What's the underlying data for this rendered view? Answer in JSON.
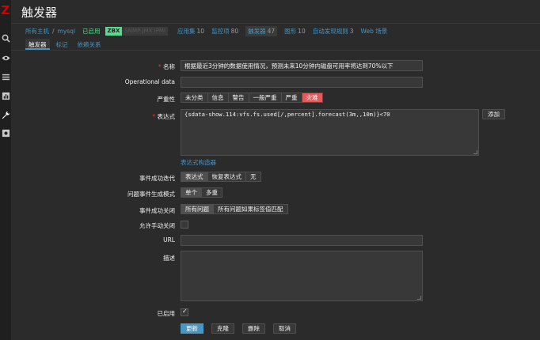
{
  "app": {
    "logo": "Z",
    "title": "触发器"
  },
  "sidebar": {
    "icons": [
      "search-icon",
      "eye-icon",
      "list-icon",
      "chart-icon",
      "wrench-icon",
      "gear-icon"
    ]
  },
  "subnav": {
    "all_hosts": "所有主机",
    "separator": "/",
    "host": "mysql",
    "status": "已启用",
    "zbx": "ZBX",
    "zbx_dim": "SNMP JMX IPMI",
    "applications": "应用集",
    "applications_count": "10",
    "items": "监控项",
    "items_count": "80",
    "triggers": "触发器",
    "triggers_count": "47",
    "graphs": "图形",
    "graphs_count": "10",
    "discovery": "自动发现规则",
    "discovery_count": "3",
    "web": "Web 场景"
  },
  "tabs": [
    {
      "label": "触发器"
    },
    {
      "label": "标记"
    },
    {
      "label": "依赖关系"
    }
  ],
  "form": {
    "name_label": "名称",
    "name_value": "根据最近3分钟的数据使用情况，预测未来10分钟内磁盘可用率将达到70%以下",
    "opdata_label": "Operational data",
    "opdata_value": "",
    "severity_label": "严重性",
    "severities": [
      "未分类",
      "信息",
      "警告",
      "一般严重",
      "严重",
      "灾难"
    ],
    "severity_selected": "灾难",
    "expression_label": "表达式",
    "expression_value": "{sdata-show.114:vfs.fs.used[/,percent].forecast(3m,,10m)}<70",
    "add_button": "添加",
    "constructor_link": "表达式构造器",
    "ok_event_label": "事件成功迭代",
    "ok_event_options": [
      "表达式",
      "恢复表达式",
      "无"
    ],
    "problem_mode_label": "问题事件生成模式",
    "problem_mode_options": [
      "单个",
      "多重"
    ],
    "ok_close_label": "事件成功关闭",
    "ok_close_options": [
      "所有问题",
      "所有问题如果标签值匹配"
    ],
    "manual_close_label": "允许手动关闭",
    "url_label": "URL",
    "url_value": "",
    "description_label": "描述",
    "description_value": "",
    "enabled_label": "已启用",
    "buttons": {
      "update": "更新",
      "clone": "克隆",
      "delete": "删除",
      "cancel": "取消"
    }
  }
}
